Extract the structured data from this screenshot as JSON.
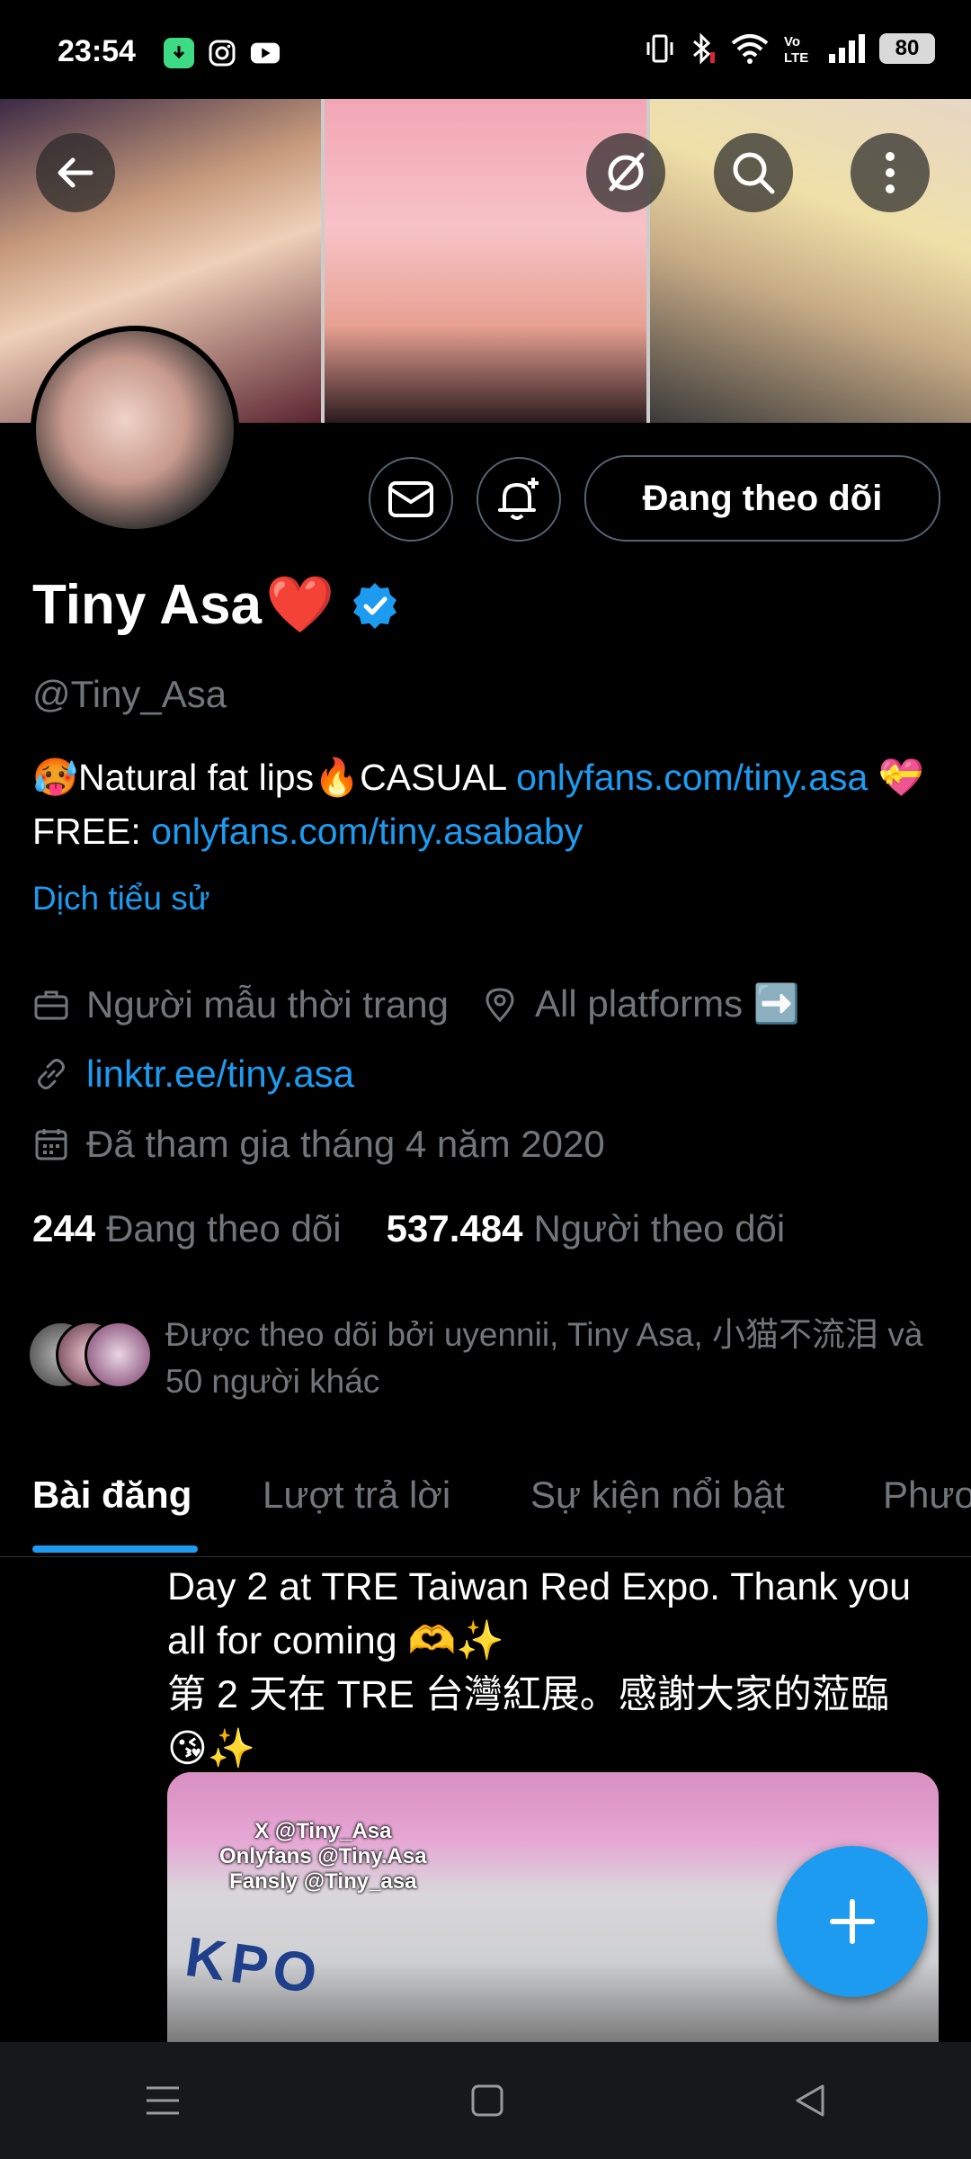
{
  "status_bar": {
    "time": "23:54",
    "battery": "80",
    "icons": [
      "android-auto-icon",
      "instagram-icon",
      "youtube-icon",
      "vibrate-icon",
      "bluetooth-icon",
      "wifi-icon",
      "volte-icon",
      "signal-icon"
    ]
  },
  "header": {
    "back_icon": "arrow-left-icon",
    "grok_icon": "grok-icon",
    "search_icon": "search-icon",
    "more_icon": "more-vertical-icon"
  },
  "actions": {
    "message_icon": "mail-icon",
    "notify_icon": "bell-plus-icon",
    "follow_label": "Đang theo dõi"
  },
  "profile": {
    "name": "Tiny Asa",
    "name_emoji": "❤️",
    "handle": "@Tiny_Asa",
    "bio_part1": "🥵Natural fat lips🔥CASUAL ",
    "bio_link1": "onlyfans.com/tiny.asa",
    "bio_part2": " 💝FREE: ",
    "bio_link2": "onlyfans.com/tiny.asababy",
    "translate": "Dịch tiểu sử",
    "profession": "Người mẫu thời trang",
    "location": "All platforms ➡️",
    "website": "linktr.ee/tiny.asa",
    "joined": "Đã tham gia tháng 4 năm 2020",
    "following_count": "244",
    "following_label": "Đang theo dõi",
    "followers_count": "537.484",
    "followers_label": "Người theo dõi",
    "followed_by": "Được theo dõi bởi uyennii, Tiny Asa, 小猫不流泪 và 50 người khác"
  },
  "tabs": [
    {
      "label": "Bài đăng"
    },
    {
      "label": "Lượt trả lời"
    },
    {
      "label": "Sự kiện nổi bật"
    },
    {
      "label": "Phươ"
    }
  ],
  "post": {
    "line1": "Day 2 at TRE Taiwan Red Expo. Thank you",
    "line2": "all for coming 🫶✨",
    "line3": "第 2 天在 TRE 台灣紅展。感謝大家的蒞臨",
    "line4": "😘✨",
    "watermark1": "X @Tiny_Asa",
    "watermark2": "Onlyfans @Tiny.Asa",
    "watermark3": "Fansly @Tiny_asa",
    "media_text": "KPO"
  },
  "fab_icon": "plus-icon",
  "navbar": [
    "menu-icon",
    "home-square-icon",
    "back-triangle-icon"
  ],
  "colors": {
    "accent": "#1d9bf0",
    "background": "#000000",
    "muted": "#71767b"
  }
}
